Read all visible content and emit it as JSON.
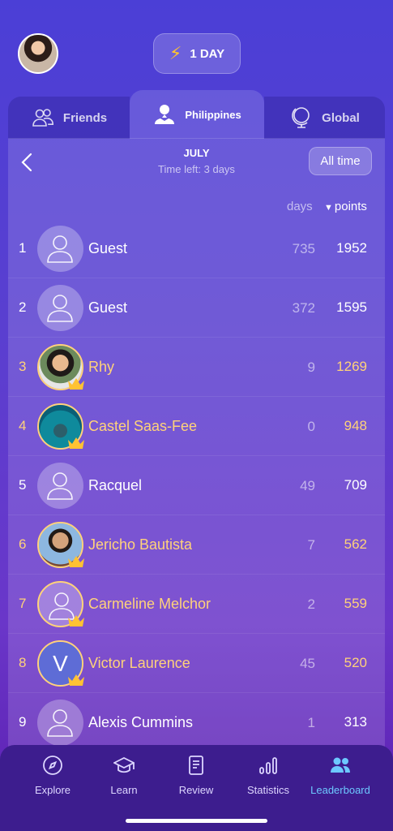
{
  "streak": {
    "label": "1 DAY",
    "icon": "lightning-icon"
  },
  "tabs": [
    {
      "label": "Friends",
      "icon": "friends-icon"
    },
    {
      "label": "Philippines",
      "icon": "location-person-icon"
    },
    {
      "label": "Global",
      "icon": "globe-icon"
    }
  ],
  "header": {
    "month": "JULY",
    "time_left": "Time left: 3 days",
    "filter": "All time"
  },
  "columns": {
    "days": "days",
    "points": "points"
  },
  "rows": [
    {
      "rank": "1",
      "name": "Guest",
      "days": "735",
      "points": "1952",
      "highlight": false,
      "avatar": "default"
    },
    {
      "rank": "2",
      "name": "Guest",
      "days": "372",
      "points": "1595",
      "highlight": false,
      "avatar": "default"
    },
    {
      "rank": "3",
      "name": "Rhy",
      "days": "9",
      "points": "1269",
      "highlight": true,
      "avatar": "photo-rhy"
    },
    {
      "rank": "4",
      "name": "Castel Saas-Fee",
      "days": "0",
      "points": "948",
      "highlight": true,
      "avatar": "photo-ocean"
    },
    {
      "rank": "5",
      "name": "Racquel",
      "days": "49",
      "points": "709",
      "highlight": false,
      "avatar": "default"
    },
    {
      "rank": "6",
      "name": "Jericho Bautista",
      "days": "7",
      "points": "562",
      "highlight": true,
      "avatar": "photo-jericho"
    },
    {
      "rank": "7",
      "name": "Carmeline Melchor",
      "days": "2",
      "points": "559",
      "highlight": true,
      "avatar": "default-gold"
    },
    {
      "rank": "8",
      "name": "Victor Laurence",
      "days": "45",
      "points": "520",
      "highlight": true,
      "avatar": "letter",
      "letter": "V"
    },
    {
      "rank": "9",
      "name": "Alexis Cummins",
      "days": "1",
      "points": "313",
      "highlight": false,
      "avatar": "default"
    }
  ],
  "nav": [
    {
      "label": "Explore",
      "icon": "compass-icon"
    },
    {
      "label": "Learn",
      "icon": "graduation-cap-icon"
    },
    {
      "label": "Review",
      "icon": "notebook-icon"
    },
    {
      "label": "Statistics",
      "icon": "bar-chart-icon"
    },
    {
      "label": "Leaderboard",
      "icon": "people-icon",
      "active": true
    }
  ],
  "colors": {
    "gold": "#ffd27a",
    "active_nav": "#6dc8ff",
    "nav_bg": "#3d1d8e"
  }
}
